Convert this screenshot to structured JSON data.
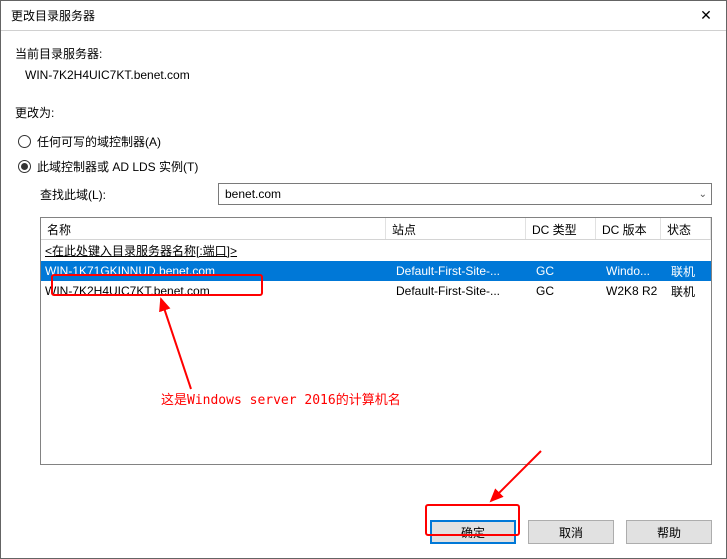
{
  "window": {
    "title": "更改目录服务器"
  },
  "currentServer": {
    "label": "当前目录服务器:",
    "value": "WIN-7K2H4UIC7KT.benet.com"
  },
  "changeTo": {
    "label": "更改为:"
  },
  "radios": {
    "anyWritable": "任何可写的域控制器(A)",
    "thisDC": "此域控制器或 AD LDS 实例(T)"
  },
  "domainLookup": {
    "label": "查找此域(L):",
    "value": "benet.com"
  },
  "table": {
    "headers": {
      "name": "名称",
      "site": "站点",
      "dctype": "DC 类型",
      "dcver": "DC 版本",
      "status": "状态"
    },
    "hint": "<在此处键入目录服务器名称[:端口]>",
    "rows": [
      {
        "name": "WIN-1K71GKINNUD.benet.com",
        "site": "Default-First-Site-...",
        "dctype": "GC",
        "dcver": "Windo...",
        "status": "联机",
        "selected": true
      },
      {
        "name": "WIN-7K2H4UIC7KT.benet.com",
        "site": "Default-First-Site-...",
        "dctype": "GC",
        "dcver": "W2K8 R2",
        "status": "联机",
        "selected": false
      }
    ]
  },
  "buttons": {
    "ok": "确定",
    "cancel": "取消",
    "help": "帮助"
  },
  "annotation": {
    "text": "这是Windows server 2016的计算机名"
  }
}
